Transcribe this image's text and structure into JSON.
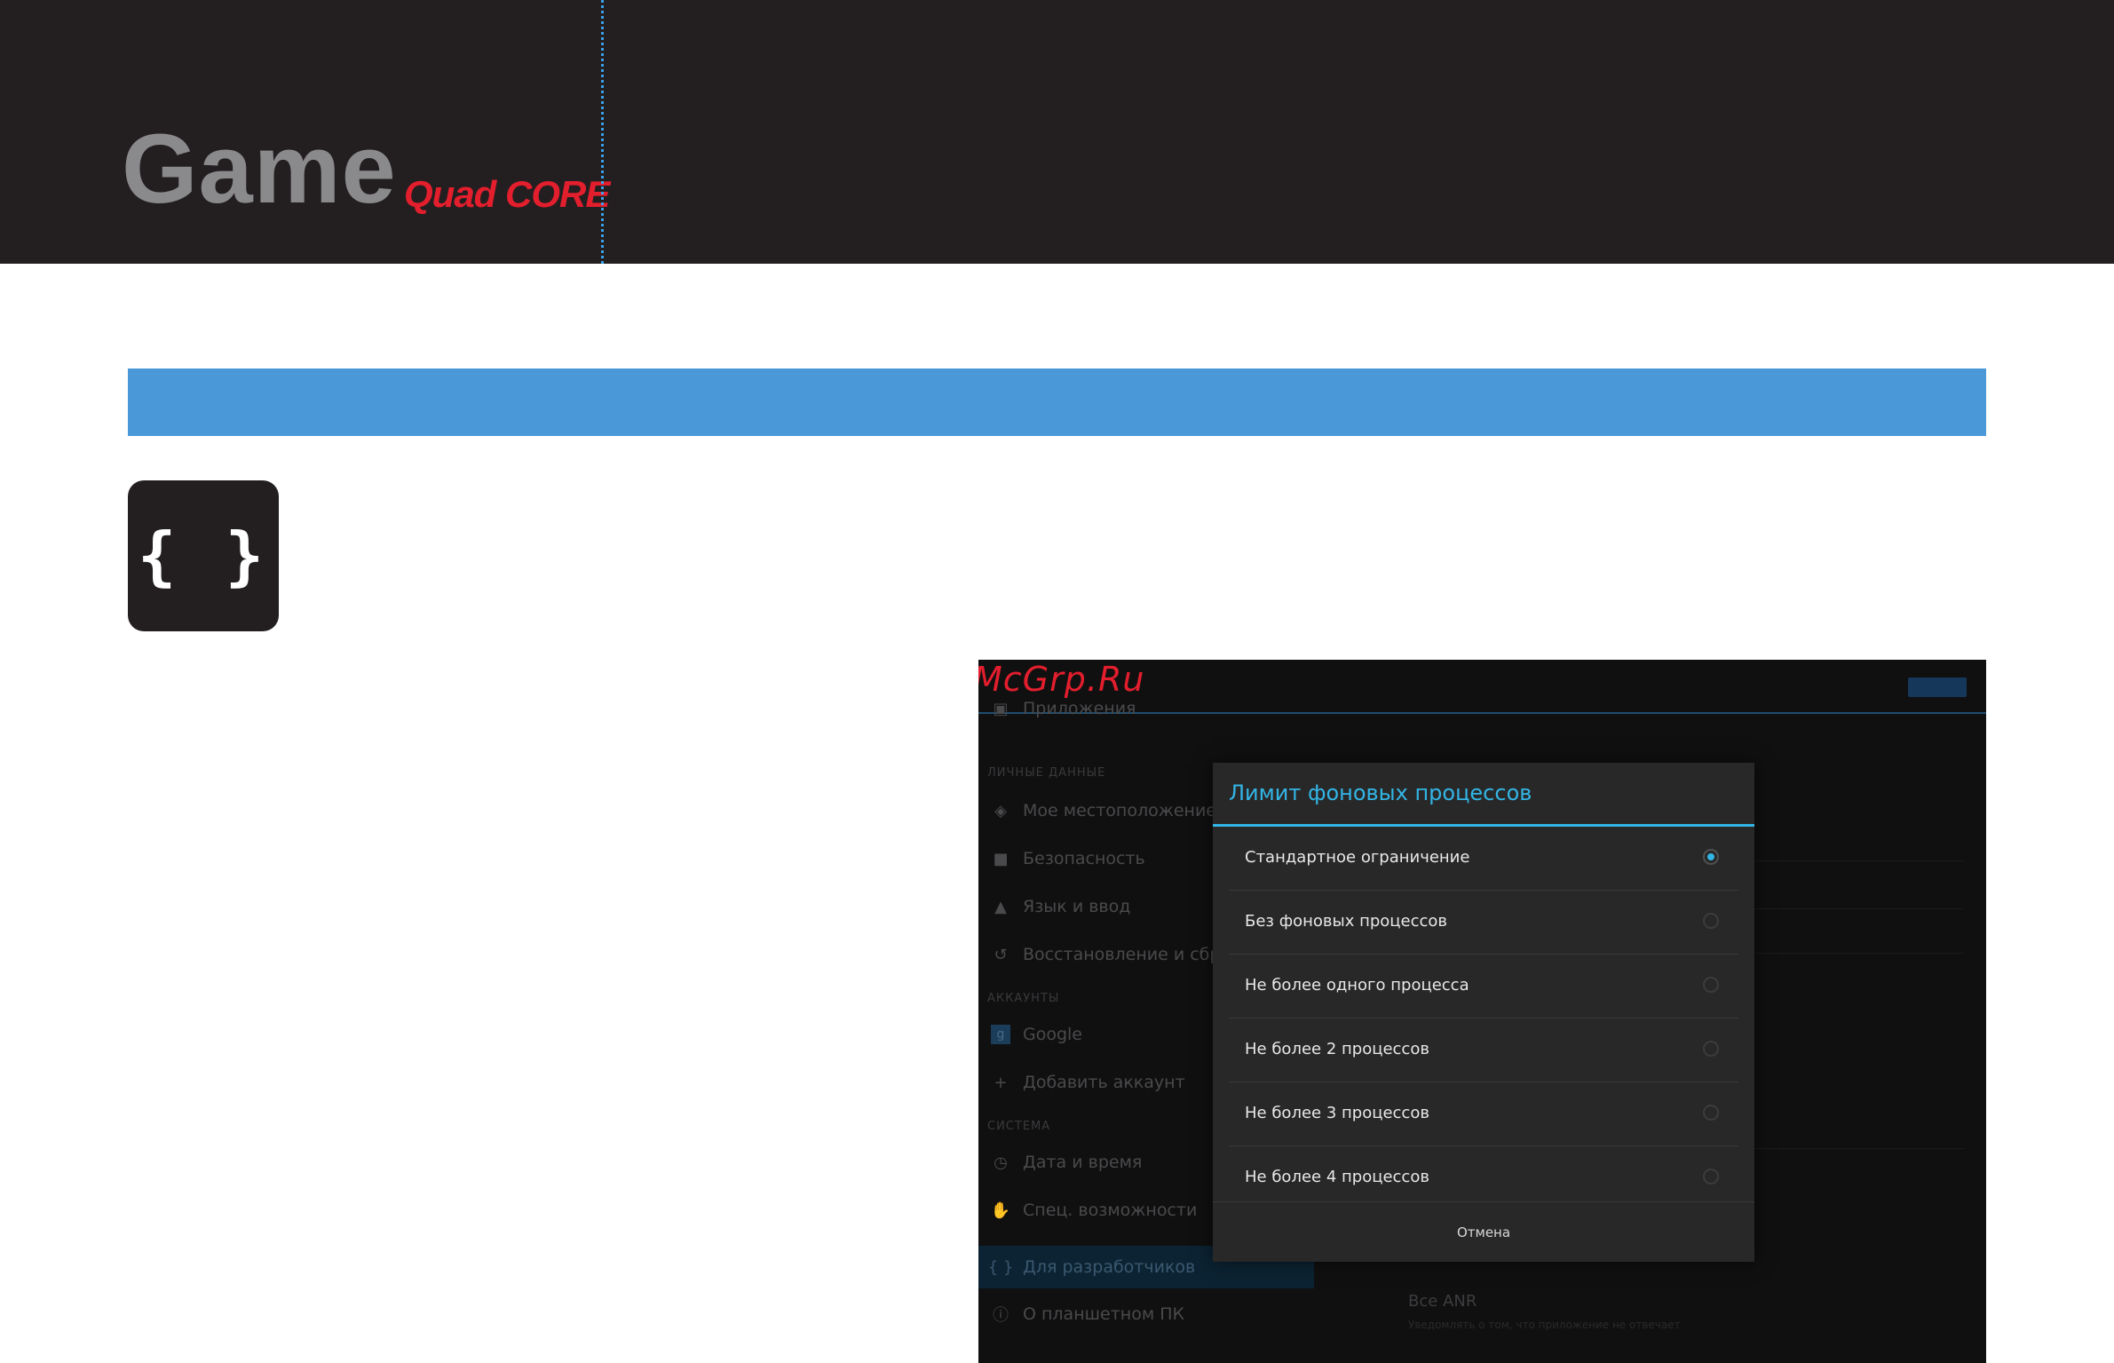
{
  "header": {
    "brand_main": "Game",
    "brand_sub": "Quad CORE"
  },
  "colors": {
    "header_bg": "#231f20",
    "brand_red": "#e31e2d",
    "section_blue": "#4a98d8",
    "holo_blue": "#33b5e5"
  },
  "section_icon": {
    "glyph": "{ }",
    "icon": "developer-braces-icon"
  },
  "screenshot": {
    "watermark": "McGrp.Ru",
    "sidebar": {
      "items_top": [
        {
          "label": "Приложения",
          "icon": "apps-icon"
        }
      ],
      "heading_personal": "ЛИЧНЫЕ ДАННЫЕ",
      "items_personal": [
        {
          "label": "Мое местоположение",
          "icon": "location-icon"
        },
        {
          "label": "Безопасность",
          "icon": "lock-icon"
        },
        {
          "label": "Язык и ввод",
          "icon": "language-icon"
        },
        {
          "label": "Восстановление и сброс",
          "icon": "restore-icon"
        }
      ],
      "heading_accounts": "АККАУНТЫ",
      "items_accounts": [
        {
          "label": "Google",
          "icon": "google-icon"
        },
        {
          "label": "Добавить аккаунт",
          "icon": "plus-icon"
        }
      ],
      "heading_system": "СИСТЕМА",
      "items_system": [
        {
          "label": "Дата и время",
          "icon": "clock-icon"
        },
        {
          "label": "Спец. возможности",
          "icon": "hand-icon"
        },
        {
          "label": "Для разработчиков",
          "icon": "braces-icon"
        },
        {
          "label": "О планшетном ПК",
          "icon": "info-icon"
        }
      ]
    },
    "background_right": {
      "anr_title": "Все ANR",
      "anr_desc": "Уведомлять о том, что приложение не отвечает"
    },
    "dialog": {
      "title": "Лимит фоновых процессов",
      "options": [
        {
          "label": "Стандартное ограничение",
          "selected": true
        },
        {
          "label": "Без фоновых процессов",
          "selected": false
        },
        {
          "label": "Не более одного процесса",
          "selected": false
        },
        {
          "label": "Не более 2 процессов",
          "selected": false
        },
        {
          "label": "Не более 3 процессов",
          "selected": false
        },
        {
          "label": "Не более 4 процессов",
          "selected": false
        }
      ],
      "cancel_label": "Отмена"
    }
  }
}
